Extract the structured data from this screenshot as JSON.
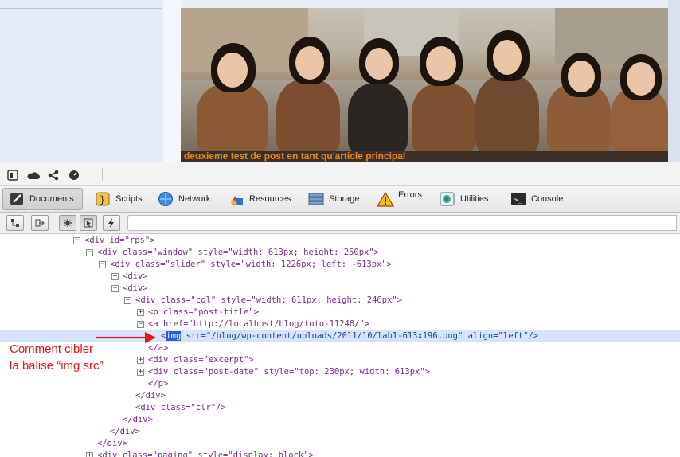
{
  "page": {
    "post_caption": "deuxieme test de post en tant qu'article principal"
  },
  "top_toolbar": {
    "icons": [
      "dock-icon",
      "cloud-icon",
      "share-icon",
      "gauge-icon"
    ]
  },
  "tabs": [
    {
      "label": "Documents",
      "icon": "documents-icon",
      "active": true
    },
    {
      "label": "Scripts",
      "icon": "scripts-icon",
      "active": false
    },
    {
      "label": "Network",
      "icon": "network-icon",
      "active": false
    },
    {
      "label": "Resources",
      "icon": "resources-icon",
      "active": false
    },
    {
      "label": "Storage",
      "icon": "storage-icon",
      "active": false
    },
    {
      "label": "Errors",
      "icon": "errors-icon",
      "active": false
    },
    {
      "label": "Utilities",
      "icon": "utilities-icon",
      "active": false
    },
    {
      "label": "Console",
      "icon": "console-icon",
      "active": false
    }
  ],
  "dom_tree": {
    "rows": [
      {
        "text": "<div id=\"rps\">"
      },
      {
        "text": "<div class=\"window\" style=\"width: 613px; height: 250px\">"
      },
      {
        "text": "<div class=\"slider\" style=\"width: 1226px; left: -613px\">"
      },
      {
        "text": "<div>"
      },
      {
        "text": "<div>"
      },
      {
        "text": "<div class=\"col\" style=\"width: 611px; height: 246px\">"
      },
      {
        "text": "<p class=\"post-title\">"
      },
      {
        "text": "<a href=\"http://localhost/blog/toto-11248/\">"
      },
      {
        "text_parts": [
          "<",
          "img",
          " src=\"/blog/wp-content/uploads/2011/10/lab1-613x196.png\" align=\"left\"/>"
        ]
      },
      {
        "text": "</a>"
      },
      {
        "text": "<div class=\"excerpt\">"
      },
      {
        "text": "<div class=\"post-date\" style=\"top: 230px; width: 613px\">"
      },
      {
        "text": "</p>"
      },
      {
        "text": "</div>"
      },
      {
        "text": "<div class=\"clr\"/>"
      },
      {
        "text": "</div>"
      },
      {
        "text": "</div>"
      },
      {
        "text": "</div>"
      },
      {
        "text": "<div class=\"paging\" style=\"display: block\">"
      }
    ]
  },
  "annotation": {
    "line1": "Comment cibler",
    "line2": "la balise “img src”",
    "color": "#e5161a"
  }
}
